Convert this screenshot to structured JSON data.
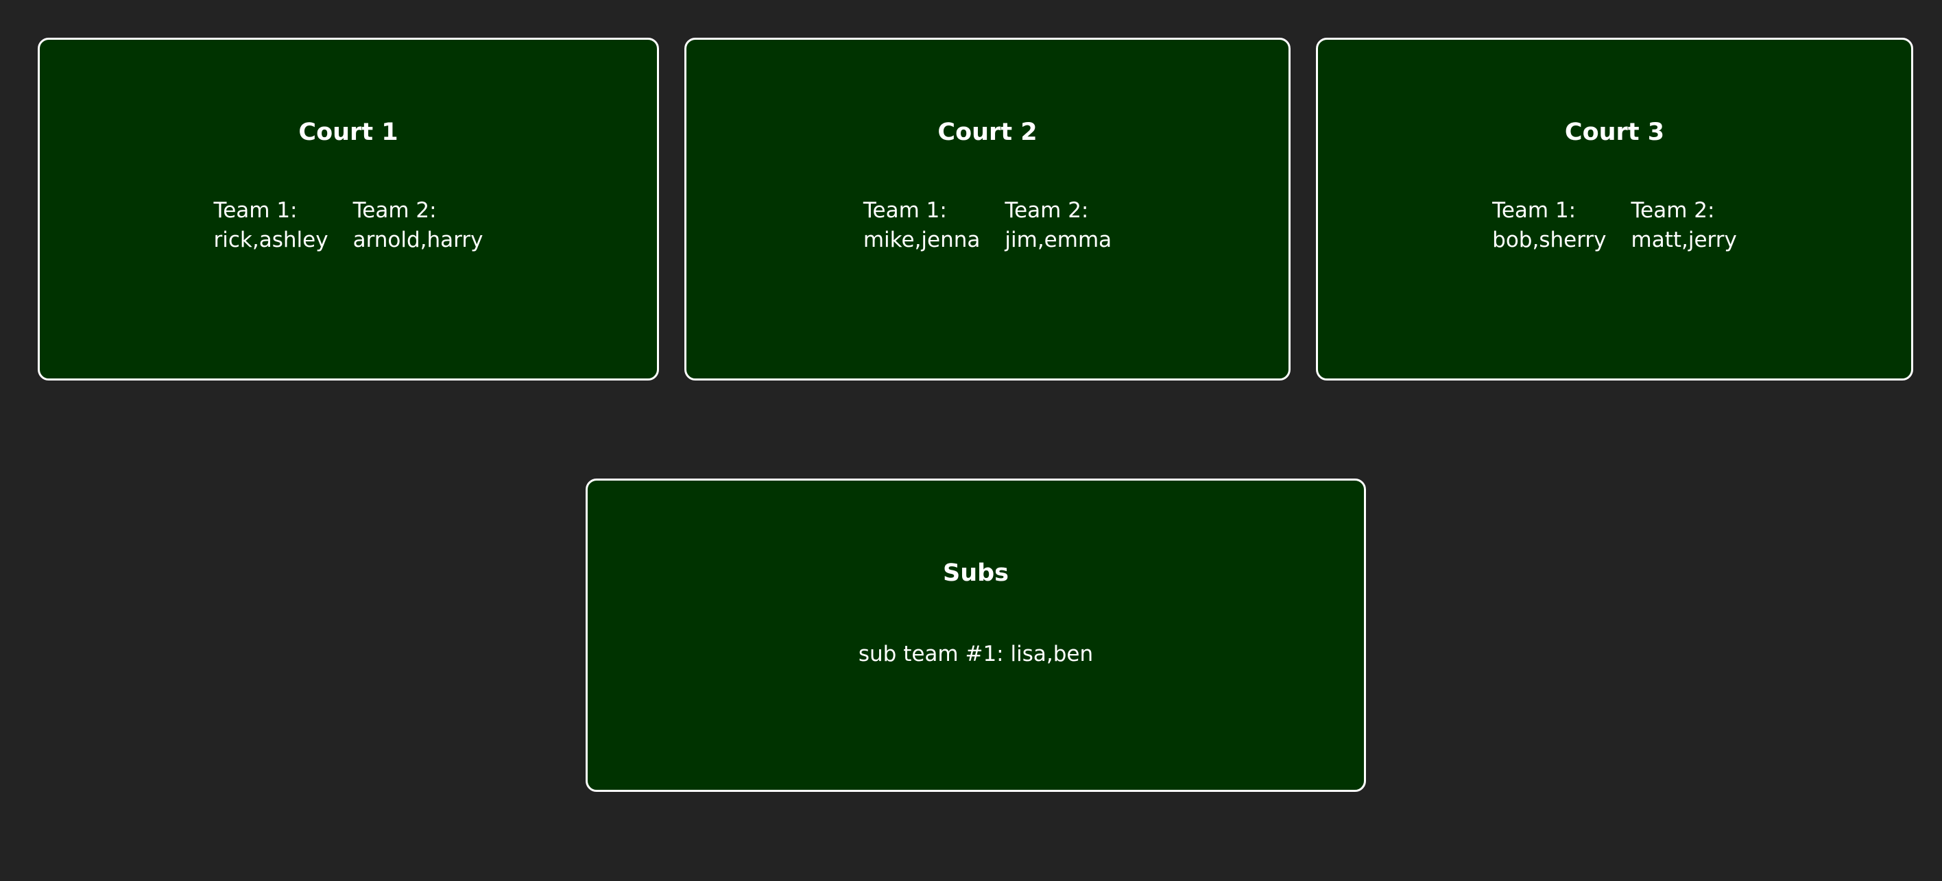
{
  "courts": [
    {
      "title": "Court 1",
      "team1": {
        "label": "Team 1:",
        "players": "rick,ashley"
      },
      "team2": {
        "label": "Team 2:",
        "players": "arnold,harry"
      }
    },
    {
      "title": "Court 2",
      "team1": {
        "label": "Team 1:",
        "players": "mike,jenna"
      },
      "team2": {
        "label": "Team 2:",
        "players": "jim,emma"
      }
    },
    {
      "title": "Court 3",
      "team1": {
        "label": "Team 1:",
        "players": "bob,sherry"
      },
      "team2": {
        "label": "Team 2:",
        "players": "matt,jerry"
      }
    }
  ],
  "subs": {
    "title": "Subs",
    "entries": [
      "sub team #1: lisa,ben"
    ]
  },
  "colors": {
    "background": "#232323",
    "card": "#003300",
    "border": "#ffffff",
    "text": "#ffffff"
  }
}
